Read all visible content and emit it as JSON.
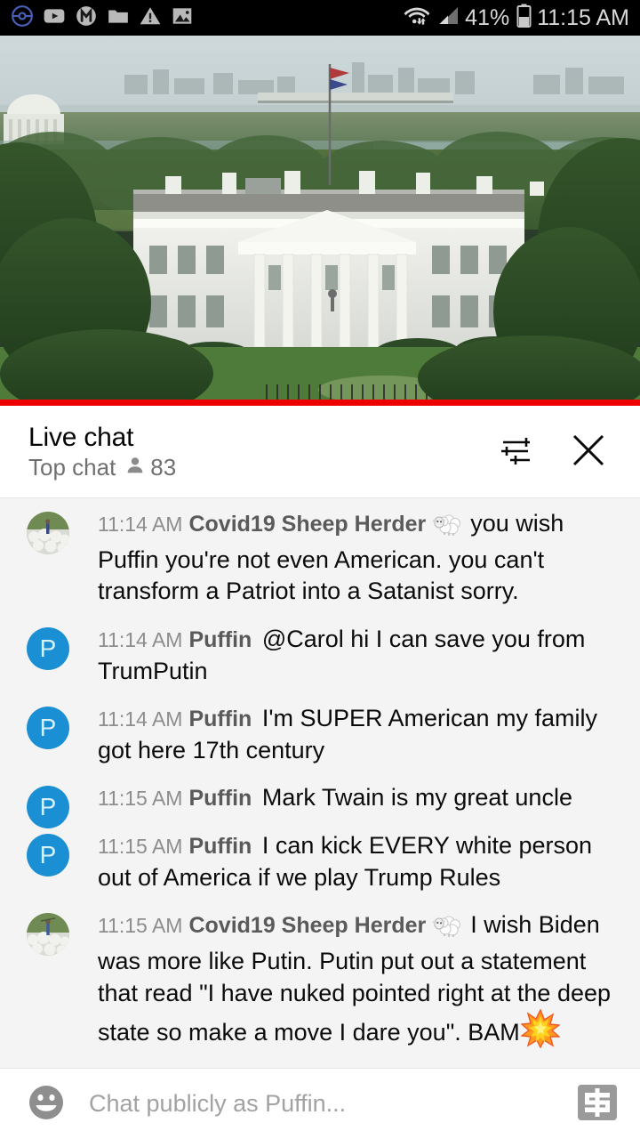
{
  "status_bar": {
    "left_icons": [
      "pokeball-icon",
      "youtube-icon",
      "m-app-icon",
      "folder-icon",
      "warning-icon",
      "image-icon"
    ],
    "right_icons": [
      "wifi-icon",
      "cellular-signal-icon",
      "battery-icon"
    ],
    "battery_percent": "41%",
    "clock": "11:15 AM",
    "background_color": "#000000",
    "text_color": "#d8d8d8"
  },
  "player": {
    "name": "live-video-player",
    "scene": "White House exterior with trees and Washington DC skyline",
    "progress_percent": 100,
    "progress_color": "#ed0000"
  },
  "chat_header": {
    "title": "Live chat",
    "subtitle": "Top chat",
    "viewer_icon": "person-icon",
    "viewer_count": "83",
    "settings_icon": "chat-settings-sliders-icon",
    "close_icon": "close-icon"
  },
  "messages": [
    {
      "avatar_type": "photo",
      "avatar_name": "sheep-herder-avatar",
      "time": "11:14 AM",
      "author": "Covid19 Sheep Herder",
      "badge": "sheep-emoji",
      "text": "you wish Puffin you're not even American. you can't transform a Patriot into a Satanist sorry.",
      "trailing_emoji": null
    },
    {
      "avatar_type": "letter",
      "avatar_name": "puffin-avatar",
      "avatar_letter": "P",
      "time": "11:14 AM",
      "author": "Puffin",
      "badge": null,
      "text": "@Carol hi I can save you from TrumPutin",
      "trailing_emoji": null
    },
    {
      "avatar_type": "letter",
      "avatar_name": "puffin-avatar",
      "avatar_letter": "P",
      "time": "11:14 AM",
      "author": "Puffin",
      "badge": null,
      "text": "I'm SUPER American my family got here 17th century",
      "trailing_emoji": null
    },
    {
      "avatar_type": "letter",
      "avatar_name": "puffin-avatar",
      "avatar_letter": "P",
      "time": "11:15 AM",
      "author": "Puffin",
      "badge": null,
      "text": "Mark Twain is my great uncle",
      "trailing_emoji": null
    },
    {
      "avatar_type": "letter",
      "avatar_name": "puffin-avatar",
      "avatar_letter": "P",
      "time": "11:15 AM",
      "author": "Puffin",
      "badge": null,
      "text": "I can kick EVERY white person out of America if we play Trump Rules",
      "trailing_emoji": null
    },
    {
      "avatar_type": "photo",
      "avatar_name": "sheep-herder-avatar",
      "time": "11:15 AM",
      "author": "Covid19 Sheep Herder",
      "badge": "sheep-emoji",
      "text": "I wish Biden was more like Putin. Putin put out a statement that read \"I have nuked pointed right at the deep state so make a move I dare you\". BAM",
      "trailing_emoji": "collision-emoji"
    }
  ],
  "composer": {
    "emoji_icon": "emoji-smiley-icon",
    "placeholder": "Chat publicly as Puffin...",
    "value": "",
    "superchat_icon": "super-chat-dollar-icon"
  },
  "colors": {
    "accent_blue": "#1b8fd4",
    "live_red": "#ed0000",
    "chat_bg": "#f4f4f4",
    "header_bg": "#ffffff"
  }
}
